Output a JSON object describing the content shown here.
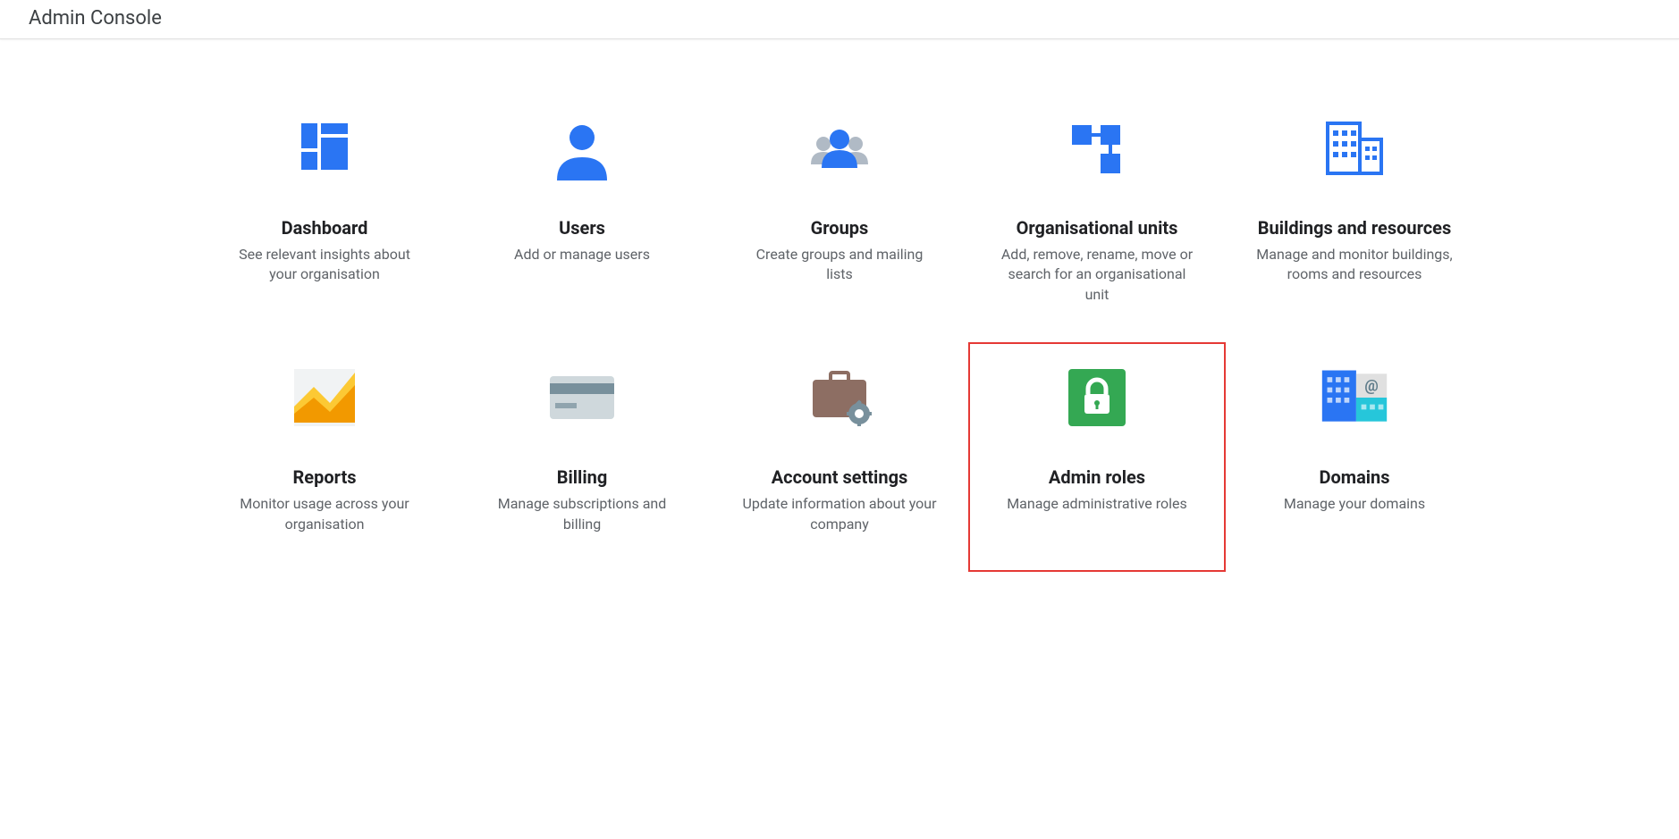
{
  "header": {
    "title": "Admin Console"
  },
  "tiles": [
    {
      "title": "Dashboard",
      "desc": "See relevant insights about your organisation"
    },
    {
      "title": "Users",
      "desc": "Add or manage users"
    },
    {
      "title": "Groups",
      "desc": "Create groups and mailing lists"
    },
    {
      "title": "Organisational units",
      "desc": "Add, remove, rename, move or search for an organisational unit"
    },
    {
      "title": "Buildings and resources",
      "desc": "Manage and monitor buildings, rooms and resources"
    },
    {
      "title": "Reports",
      "desc": "Monitor usage across your organisation"
    },
    {
      "title": "Billing",
      "desc": "Manage subscriptions and billing"
    },
    {
      "title": "Account settings",
      "desc": "Update information about your company"
    },
    {
      "title": "Admin roles",
      "desc": "Manage administrative roles"
    },
    {
      "title": "Domains",
      "desc": "Manage your domains"
    }
  ]
}
